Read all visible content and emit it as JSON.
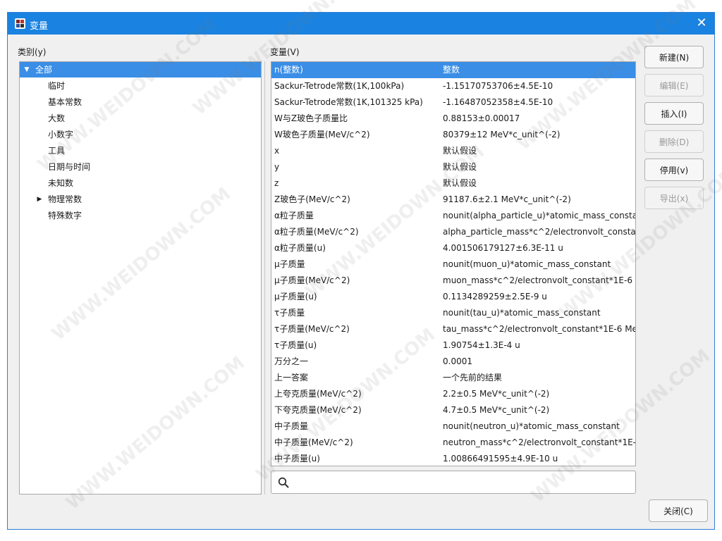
{
  "window": {
    "title": "变量",
    "close_symbol": "✕"
  },
  "category": {
    "label": "类别(y)",
    "items": [
      {
        "label": "全部",
        "expanded": true,
        "selected": true,
        "level": 0
      },
      {
        "label": "临时",
        "level": 1
      },
      {
        "label": "基本常数",
        "level": 1
      },
      {
        "label": "大数",
        "level": 1
      },
      {
        "label": "小数字",
        "level": 1
      },
      {
        "label": "工具",
        "level": 1
      },
      {
        "label": "日期与时间",
        "level": 1
      },
      {
        "label": "未知数",
        "level": 1
      },
      {
        "label": "物理常数",
        "level": 1,
        "collapsed": true
      },
      {
        "label": "特殊数字",
        "level": 1
      }
    ],
    "expanded_arrow": "▼",
    "collapsed_arrow": "▶"
  },
  "variables": {
    "label": "变量(V)",
    "rows": [
      {
        "name": "n(整数)",
        "value": "整数"
      },
      {
        "name": "Sackur-Tetrode常数(1K,100kPa)",
        "value": "-1.15170753706±4.5E-10"
      },
      {
        "name": "Sackur-Tetrode常数(1K,101325 kPa)",
        "value": "-1.16487052358±4.5E-10"
      },
      {
        "name": "W与Z玻色子质量比",
        "value": "0.88153±0.00017"
      },
      {
        "name": "W玻色子质量(MeV/c^2)",
        "value": "80379±12 MeV*c_unit^(-2)"
      },
      {
        "name": "x",
        "value": "默认假设"
      },
      {
        "name": "y",
        "value": "默认假设"
      },
      {
        "name": "z",
        "value": "默认假设"
      },
      {
        "name": "Z玻色子(MeV/c^2)",
        "value": "91187.6±2.1 MeV*c_unit^(-2)"
      },
      {
        "name": "α粒子质量",
        "value": "nounit(alpha_particle_u)*atomic_mass_constant"
      },
      {
        "name": "α粒子质量(MeV/c^2)",
        "value": "alpha_particle_mass*c^2/electronvolt_constant*"
      },
      {
        "name": "α粒子质量(u)",
        "value": "4.001506179127±6.3E-11 u"
      },
      {
        "name": "μ子质量",
        "value": "nounit(muon_u)*atomic_mass_constant"
      },
      {
        "name": "μ子质量(MeV/c^2)",
        "value": "muon_mass*c^2/electronvolt_constant*1E-6 Me"
      },
      {
        "name": "μ子质量(u)",
        "value": "0.1134289259±2.5E-9 u"
      },
      {
        "name": "τ子质量",
        "value": "nounit(tau_u)*atomic_mass_constant"
      },
      {
        "name": "τ子质量(MeV/c^2)",
        "value": "tau_mass*c^2/electronvolt_constant*1E-6 MeV*"
      },
      {
        "name": "τ子质量(u)",
        "value": "1.90754±1.3E-4 u"
      },
      {
        "name": "万分之一",
        "value": "0.0001"
      },
      {
        "name": "上一答案",
        "value": "一个先前的结果"
      },
      {
        "name": "上夸克质量(MeV/c^2)",
        "value": "2.2±0.5 MeV*c_unit^(-2)"
      },
      {
        "name": "下夸克质量(MeV/c^2)",
        "value": "4.7±0.5 MeV*c_unit^(-2)"
      },
      {
        "name": "中子质量",
        "value": "nounit(neutron_u)*atomic_mass_constant"
      },
      {
        "name": "中子质量(MeV/c^2)",
        "value": "neutron_mass*c^2/electronvolt_constant*1E-6 M"
      },
      {
        "name": "中子质量(u)",
        "value": "1.00866491595±4.9E-10 u"
      }
    ]
  },
  "search": {
    "value": "",
    "placeholder": ""
  },
  "buttons": {
    "new": "新建(N)",
    "edit": "编辑(E)",
    "insert": "插入(I)",
    "delete": "删除(D)",
    "disable": "停用(v)",
    "export": "导出(x)",
    "close": "关闭(C)"
  },
  "colors": {
    "titlebar": "#1a82e0",
    "selection": "#3a8ee6"
  },
  "watermark": "WWW.WEIDOWN.COM"
}
